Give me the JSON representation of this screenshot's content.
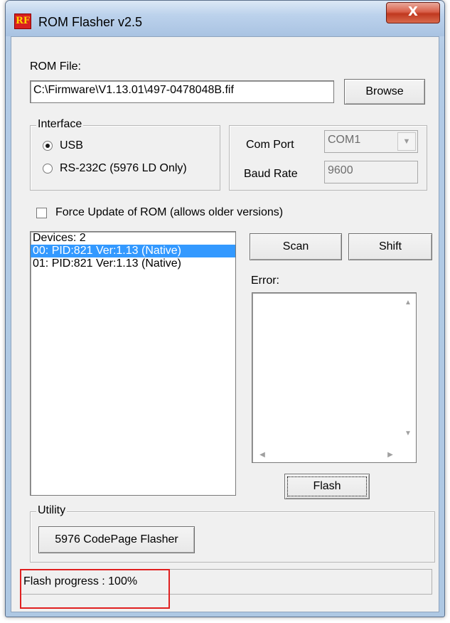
{
  "window": {
    "title": "ROM Flasher v2.5",
    "close_glyph": "X",
    "app_icon": "RF-logo-icon"
  },
  "rom_file": {
    "label": "ROM File:",
    "value": "C:\\Firmware\\V1.13.01\\497-0478048B.fif",
    "browse_label": "Browse"
  },
  "interface": {
    "title": "Interface",
    "options": [
      {
        "label": "USB",
        "selected": true
      },
      {
        "label": "RS-232C (5976 LD Only)",
        "selected": false
      }
    ]
  },
  "port": {
    "com_port_label": "Com Port",
    "com_port_value": "COM1",
    "baud_rate_label": "Baud Rate",
    "baud_rate_value": "9600"
  },
  "force_update": {
    "label": "Force Update of ROM (allows older versions)",
    "checked": false
  },
  "devices": {
    "header": "Devices: 2",
    "items": [
      {
        "text": "00: PID:821  Ver:1.13 (Native)",
        "selected": true
      },
      {
        "text": "01: PID:821  Ver:1.13 (Native)",
        "selected": false
      }
    ]
  },
  "actions": {
    "scan_label": "Scan",
    "shift_label": "Shift",
    "error_label": "Error:",
    "error_text": "",
    "flash_label": "Flash"
  },
  "utility": {
    "title": "Utility",
    "codepage_label": "5976 CodePage Flasher"
  },
  "status": {
    "text": "Flash progress : 100%",
    "highlight_color": "#e02020"
  },
  "colors": {
    "selection": "#3399ff",
    "close_button": "#c0381f"
  }
}
